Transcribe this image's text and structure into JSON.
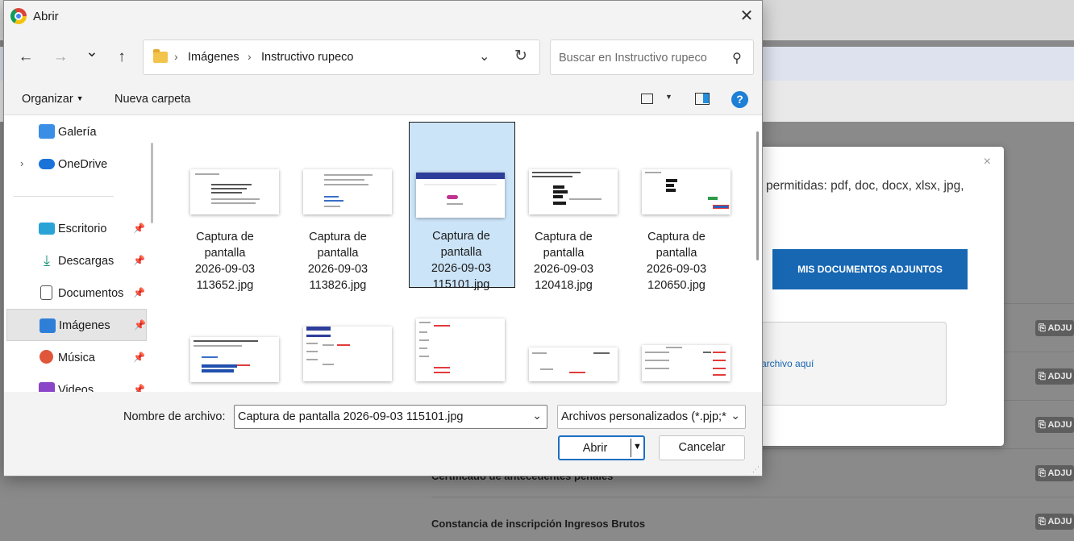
{
  "background": {
    "modal": {
      "close_icon": "×",
      "text": "permitidas: pdf, doc, docx, xlsx, jpg,",
      "button_label": "MIS DOCUMENTOS ADJUNTOS",
      "dropzone_text": "archivo aquí"
    },
    "rows": [
      {
        "label": "",
        "button": "ADJU"
      },
      {
        "label": "",
        "button": "ADJU"
      },
      {
        "label": "",
        "button": "ADJU"
      },
      {
        "label": "Certificado de antecedentes penales",
        "button": "ADJU"
      },
      {
        "label": "Constancia de inscripción Ingresos Brutos",
        "button": "ADJU"
      }
    ],
    "colors": {
      "modal_button": "#1767b3",
      "link": "#1767b3"
    }
  },
  "dialog": {
    "title": "Abrir",
    "close_icon": "✕",
    "nav": {
      "back": "←",
      "forward": "→",
      "recent": "⌄",
      "up": "↑"
    },
    "address": {
      "crumbs": [
        "Imágenes",
        "Instructivo rupeco"
      ],
      "separator": "›",
      "dropdown_icon": "⌄",
      "refresh_icon": "↻"
    },
    "search": {
      "placeholder": "Buscar en Instructivo rupeco",
      "icon": "⚲"
    },
    "toolbar": {
      "organize": "Organizar",
      "new_folder": "Nueva carpeta",
      "help": "?"
    },
    "navpane": {
      "items": [
        {
          "label": "Galería",
          "icon": "gallery-icon"
        },
        {
          "label": "OneDrive",
          "icon": "onedrive-icon",
          "chevron": "›"
        },
        {
          "label": "Escritorio",
          "icon": "desktop-icon",
          "pin": "📌"
        },
        {
          "label": "Descargas",
          "icon": "download-icon",
          "pin": "📌"
        },
        {
          "label": "Documentos",
          "icon": "documents-icon",
          "pin": "📌"
        },
        {
          "label": "Imágenes",
          "icon": "pictures-icon",
          "pin": "📌",
          "selected": true
        },
        {
          "label": "Música",
          "icon": "music-icon",
          "pin": "📌"
        },
        {
          "label": "Videos",
          "icon": "videos-icon",
          "pin": "📌"
        }
      ]
    },
    "files": [
      {
        "name_lines": [
          "Captura de",
          "pantalla",
          "2026-09-03",
          "113652.jpg"
        ]
      },
      {
        "name_lines": [
          "Captura de",
          "pantalla",
          "2026-09-03",
          "113826.jpg"
        ]
      },
      {
        "name_lines": [
          "Captura de",
          "pantalla",
          "2026-09-03",
          "115101.jpg"
        ],
        "selected": true
      },
      {
        "name_lines": [
          "Captura de",
          "pantalla",
          "2026-09-03",
          "120418.jpg"
        ]
      },
      {
        "name_lines": [
          "Captura de",
          "pantalla",
          "2026-09-03",
          "120650.jpg"
        ]
      }
    ],
    "bottom": {
      "filename_label": "Nombre de archivo:",
      "filename_value": "Captura de pantalla 2026-09-03 115101.jpg",
      "filetype_value": "Archivos personalizados (*.pjp;*",
      "dropdown_icon": "⌄",
      "open_label": "Abrir",
      "open_caret": "▼",
      "cancel_label": "Cancelar"
    },
    "colors": {
      "selection": "#cce4f7",
      "accent": "#1d6fc4",
      "help": "#1d7fd6"
    }
  }
}
